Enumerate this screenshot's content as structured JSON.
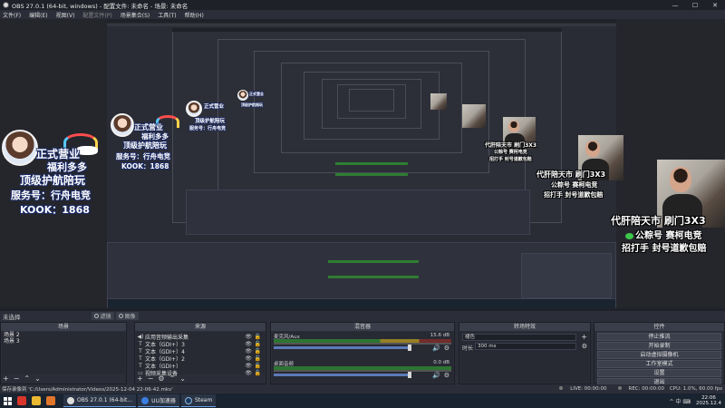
{
  "window": {
    "title": "OBS 27.0.1 (64-bit, windows) - 配置文件: 未命名 - 场景: 未命名",
    "minimize": "—",
    "maximize": "☐",
    "close": "✕"
  },
  "menu": [
    "文件(F)",
    "编辑(E)",
    "视图(V)",
    "配置文件(P)",
    "场景集合(S)",
    "工具(T)",
    "帮助(H)"
  ],
  "overlay": {
    "badge_lines": [
      "正式营业",
      "福利多多",
      "顶级护航陪玩",
      "服务号：行舟电竞",
      "KOOK：1868"
    ],
    "ad_line1": "代肝陪天市 刷门3X3",
    "ad_line2": "公粽号 赛柯电竞",
    "ad_line3": "招打手 封号道歉包赔"
  },
  "scene_bar": {
    "name": "未选择",
    "tab1": "滤镜",
    "tab2": "图像"
  },
  "docks": {
    "scenes": {
      "title": "场景",
      "items": [
        "场景 2",
        "场景 3"
      ]
    },
    "sources": {
      "title": "来源",
      "items": [
        {
          "icon": "◀)",
          "label": "应用音频输出采集"
        },
        {
          "icon": "T",
          "label": "文本（GDI+）3"
        },
        {
          "icon": "T",
          "label": "文本（GDI+）4"
        },
        {
          "icon": "T",
          "label": "文本（GDI+）2"
        },
        {
          "icon": "T",
          "label": "文本（GDI+）"
        },
        {
          "icon": "▭",
          "label": "视频采集设备"
        }
      ]
    },
    "mixer": {
      "title": "混音器",
      "channels": [
        {
          "name": "麦克风/Aux",
          "db": "15.6 dB"
        },
        {
          "name": "桌面音频",
          "db": "0.0 dB"
        }
      ]
    },
    "transitions": {
      "title": "转场特效",
      "type": "褪色",
      "duration_label": "时长",
      "duration": "300 ms"
    },
    "controls": {
      "title": "控件",
      "buttons": [
        "停止推流",
        "开始录制",
        "启动虚拟摄像机",
        "工作室模式",
        "设置",
        "退出"
      ]
    }
  },
  "footer_icons": {
    "add": "+",
    "remove": "−",
    "up": "⌃",
    "down": "⌄"
  },
  "status": {
    "path": "保存录像到 'C:/Users/Administrator/Videos/2025-12-04 22-06-42.mkv'",
    "live": "LIVE: 00:00:00",
    "rec": "REC: 00:00:00",
    "cpu": "CPU: 1.0%, 60.00 fps"
  },
  "taskbar": {
    "tasks": [
      "OBS 27.0.1 (64-bit...",
      "UU加速器",
      "Steam"
    ],
    "time": "22:06",
    "date": "2025.12.4",
    "sys": "^ 中 ⌨"
  },
  "colors": {
    "accent_fader": "#5d7ab8",
    "meter_green": "#2e7d32",
    "wechat_green": "#3cc84a",
    "taskbar": "#1a2330"
  }
}
